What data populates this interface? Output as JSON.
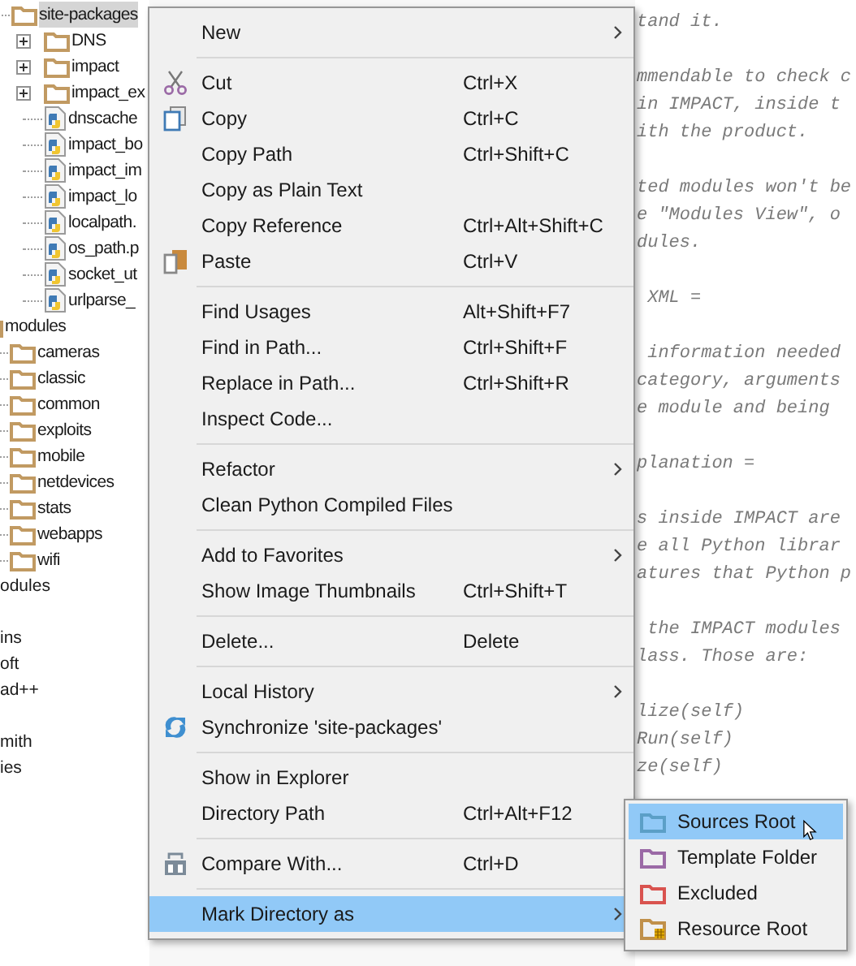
{
  "tree": {
    "nested_under_parent_above": [
      {
        "label": "site-packages",
        "kind": "folder",
        "selected": true,
        "children": [
          {
            "label": "DNS",
            "kind": "folder",
            "expanded": false,
            "selected": false
          },
          {
            "label": "impact",
            "kind": "folder",
            "expanded": false,
            "selected": false
          },
          {
            "label": "impact_ex",
            "kind": "folder",
            "expanded": false,
            "selected": false
          },
          {
            "label": "dnscache",
            "kind": "python",
            "selected": false
          },
          {
            "label": "impact_bo",
            "kind": "python",
            "selected": false
          },
          {
            "label": "impact_im",
            "kind": "python",
            "selected": false
          },
          {
            "label": "impact_lo",
            "kind": "python",
            "selected": false
          },
          {
            "label": "localpath.",
            "kind": "python",
            "selected": false
          },
          {
            "label": "os_path.p",
            "kind": "python",
            "selected": false
          },
          {
            "label": "socket_ut",
            "kind": "python",
            "selected": false
          },
          {
            "label": "urlparse_",
            "kind": "python",
            "selected": false
          }
        ]
      }
    ],
    "items": [
      {
        "label": "modules",
        "kind": "folder",
        "selected": false,
        "children": [
          {
            "label": "cameras",
            "kind": "folder",
            "selected": false
          },
          {
            "label": "classic",
            "kind": "folder",
            "selected": false
          },
          {
            "label": "common",
            "kind": "folder",
            "selected": false
          },
          {
            "label": "exploits",
            "kind": "folder",
            "selected": false
          },
          {
            "label": "mobile",
            "kind": "folder",
            "selected": false
          },
          {
            "label": "netdevices",
            "kind": "folder",
            "selected": false
          },
          {
            "label": "stats",
            "kind": "folder",
            "selected": false
          },
          {
            "label": "webapps",
            "kind": "folder",
            "selected": false
          },
          {
            "label": "wifi",
            "kind": "folder",
            "selected": false
          }
        ]
      }
    ],
    "outer_items": [
      {
        "label": "odules",
        "selected": false
      },
      {
        "label": "ins",
        "selected": false,
        "gap_before": true
      },
      {
        "label": "oft",
        "selected": false
      },
      {
        "label": "ad++",
        "selected": false
      },
      {
        "label": "mith",
        "selected": false,
        "gap_before": true
      },
      {
        "label": "ies",
        "selected": false
      }
    ]
  },
  "editor": {
    "paragraphs": [
      [
        "tand it."
      ],
      [
        "mmendable to check c",
        "in IMPACT, inside t",
        "ith the product."
      ],
      [
        "ted modules won't be",
        "e \"Modules View\", o",
        "dules."
      ],
      [
        " XML ="
      ],
      [
        " information needed",
        "category, arguments",
        "e module and being"
      ],
      [
        "planation ="
      ],
      [
        "s inside IMPACT are",
        "e all Python librar",
        "atures that Python p"
      ],
      [
        " the IMPACT modules",
        "lass. Those are:"
      ],
      [
        "lize(self)",
        "Run(self)",
        "ze(self)"
      ]
    ]
  },
  "context_menu": {
    "groups": [
      [
        {
          "label": "New",
          "submenu": true,
          "selected": false
        }
      ],
      [
        {
          "label": "Cut",
          "shortcut": "Ctrl+X",
          "kind": "cut",
          "selected": false
        },
        {
          "label": "Copy",
          "shortcut": "Ctrl+C",
          "kind": "copy",
          "selected": false
        },
        {
          "label": "Copy Path",
          "shortcut": "Ctrl+Shift+C",
          "selected": false
        },
        {
          "label": "Copy as Plain Text",
          "selected": false
        },
        {
          "label": "Copy Reference",
          "shortcut": "Ctrl+Alt+Shift+C",
          "selected": false
        },
        {
          "label": "Paste",
          "shortcut": "Ctrl+V",
          "kind": "paste",
          "selected": false
        }
      ],
      [
        {
          "label": "Find Usages",
          "shortcut": "Alt+Shift+F7",
          "selected": false
        },
        {
          "label": "Find in Path...",
          "shortcut": "Ctrl+Shift+F",
          "selected": false
        },
        {
          "label": "Replace in Path...",
          "shortcut": "Ctrl+Shift+R",
          "selected": false
        },
        {
          "label": "Inspect Code...",
          "selected": false
        }
      ],
      [
        {
          "label": "Refactor",
          "submenu": true,
          "selected": false
        },
        {
          "label": "Clean Python Compiled Files",
          "selected": false
        }
      ],
      [
        {
          "label": "Add to Favorites",
          "submenu": true,
          "selected": false
        },
        {
          "label": "Show Image Thumbnails",
          "shortcut": "Ctrl+Shift+T",
          "selected": false
        }
      ],
      [
        {
          "label": "Delete...",
          "shortcut": "Delete",
          "selected": false
        }
      ],
      [
        {
          "label": "Local History",
          "submenu": true,
          "selected": false
        },
        {
          "label": "Synchronize 'site-packages'",
          "kind": "sync",
          "selected": false
        }
      ],
      [
        {
          "label": "Show in Explorer",
          "selected": false
        },
        {
          "label": "Directory Path",
          "shortcut": "Ctrl+Alt+F12",
          "selected": false
        }
      ],
      [
        {
          "label": "Compare With...",
          "shortcut": "Ctrl+D",
          "kind": "compare",
          "selected": false
        }
      ],
      [
        {
          "label": "Mark Directory as",
          "submenu": true,
          "selected": true
        }
      ]
    ]
  },
  "submenu": {
    "items": [
      {
        "label": "Sources Root",
        "kind": "folder",
        "color": "#5b9fc7",
        "selected": true
      },
      {
        "label": "Template Folder",
        "kind": "folder",
        "color": "#9b6aa6",
        "selected": false
      },
      {
        "label": "Excluded",
        "kind": "folder",
        "color": "#d9534f",
        "selected": false
      },
      {
        "label": "Resource Root",
        "kind": "resource",
        "color": "#c0904a",
        "selected": false
      }
    ]
  }
}
